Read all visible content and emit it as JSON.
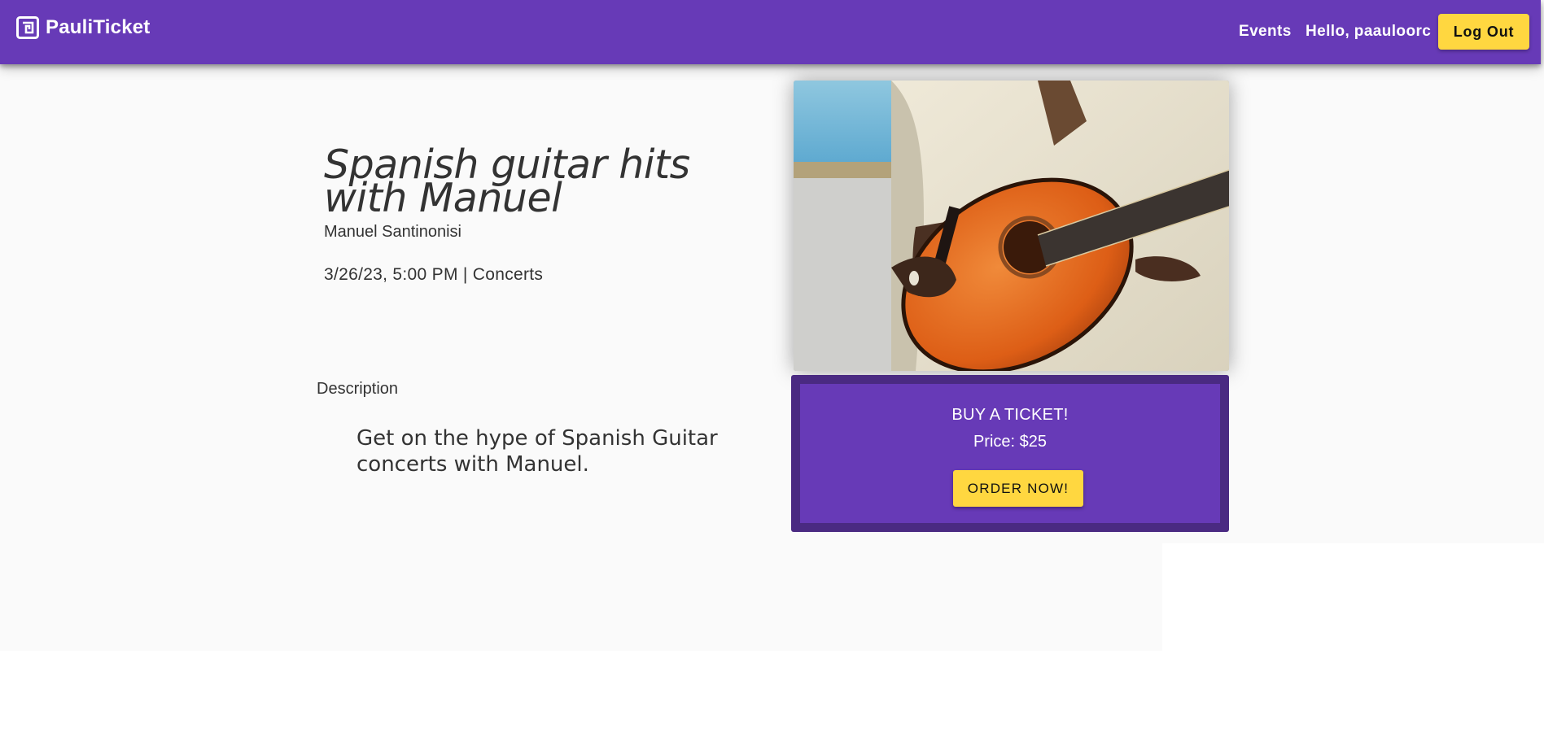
{
  "header": {
    "brand_name": "PauliTicket",
    "nav_events": "Events",
    "greeting": "Hello, paauloorc",
    "logout_label": "Log Out"
  },
  "event": {
    "title": "Spanish guitar hits with Manuel",
    "artist": "Manuel Santinonisi",
    "meta": "3/26/23, 5:00 PM | Concerts",
    "description_label": "Description",
    "description": "Get on the hype of Spanish Guitar concerts with Manuel."
  },
  "ticket": {
    "heading": "BUY A TICKET!",
    "price": "Price: $25",
    "order_label": "ORDER NOW!"
  },
  "colors": {
    "primary": "#673ab7",
    "primary_dark": "#4a2a82",
    "accent": "#ffd740",
    "background": "#fafafa"
  },
  "icons": {
    "brand": "ticket-logo-icon"
  }
}
